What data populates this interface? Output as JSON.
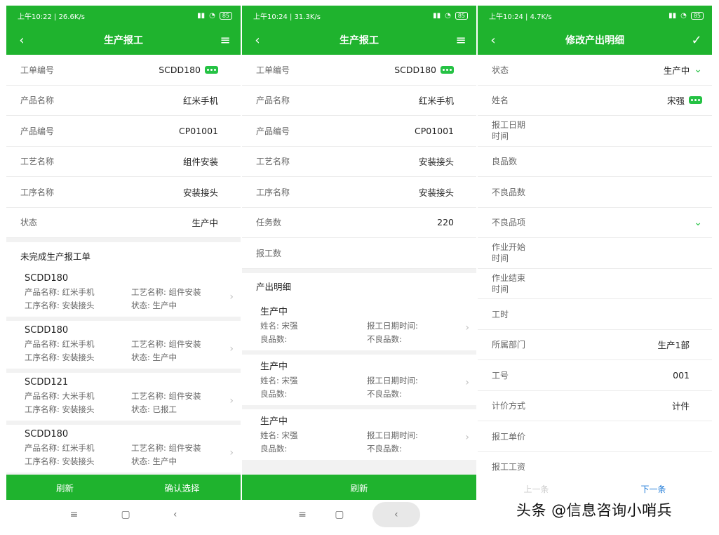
{
  "screen1": {
    "status": {
      "time": "上午10:22",
      "speed": "26.6K/s",
      "battery": "85"
    },
    "title": "生产报工",
    "fields": [
      {
        "label": "工单编号",
        "value": "SCDD180"
      },
      {
        "label": "产品名称",
        "value": "红米手机"
      },
      {
        "label": "产品编号",
        "value": "CP01001"
      },
      {
        "label": "工艺名称",
        "value": "组件安装"
      },
      {
        "label": "工序名称",
        "value": "安装接头"
      },
      {
        "label": "状态",
        "value": "生产中"
      }
    ],
    "section_title": "未完成生产报工单",
    "cards": [
      {
        "code": "SCDD180",
        "product": "产品名称: 红米手机",
        "craft": "工艺名称: 组件安装",
        "process": "工序名称: 安装接头",
        "state": "状态: 生产中"
      },
      {
        "code": "SCDD180",
        "product": "产品名称: 红米手机",
        "craft": "工艺名称: 组件安装",
        "process": "工序名称: 安装接头",
        "state": "状态: 生产中"
      },
      {
        "code": "SCDD121",
        "product": "产品名称: 大米手机",
        "craft": "工艺名称: 组件安装",
        "process": "工序名称: 安装接头",
        "state": "状态: 已报工"
      },
      {
        "code": "SCDD180",
        "product": "产品名称: 红米手机",
        "craft": "工艺名称: 组件安装",
        "process": "工序名称: 安装接头",
        "state": "状态: 生产中"
      }
    ],
    "footer": {
      "refresh": "刷新",
      "confirm": "确认选择"
    }
  },
  "screen2": {
    "status": {
      "time": "上午10:24",
      "speed": "31.3K/s",
      "battery": "85"
    },
    "title": "生产报工",
    "fields": [
      {
        "label": "工单编号",
        "value": "SCDD180"
      },
      {
        "label": "产品名称",
        "value": "红米手机"
      },
      {
        "label": "产品编号",
        "value": "CP01001"
      },
      {
        "label": "工艺名称",
        "value": "安装接头"
      },
      {
        "label": "工序名称",
        "value": "安装接头"
      },
      {
        "label": "任务数",
        "value": "220"
      },
      {
        "label": "报工数",
        "value": ""
      }
    ],
    "section_title": "产出明细",
    "cards": [
      {
        "code": "生产中",
        "name": "姓名: 宋强",
        "date": "报工日期时间:",
        "good": "良品数:",
        "bad": "不良品数:"
      },
      {
        "code": "生产中",
        "name": "姓名: 宋强",
        "date": "报工日期时间:",
        "good": "良品数:",
        "bad": "不良品数:"
      },
      {
        "code": "生产中",
        "name": "姓名: 宋强",
        "date": "报工日期时间:",
        "good": "良品数:",
        "bad": "不良品数:"
      }
    ],
    "footer": {
      "refresh": "刷新"
    }
  },
  "screen3": {
    "status": {
      "time": "上午10:24",
      "speed": "4.7K/s",
      "battery": "85"
    },
    "title": "修改产出明细",
    "fields": [
      {
        "label": "状态",
        "value": "生产中"
      },
      {
        "label": "姓名",
        "value": "宋强"
      },
      {
        "label": "报工日期\n时间",
        "value": ""
      },
      {
        "label": "良品数",
        "value": ""
      },
      {
        "label": "不良品数",
        "value": ""
      },
      {
        "label": "不良品项",
        "value": ""
      },
      {
        "label": "作业开始\n时间",
        "value": ""
      },
      {
        "label": "作业结束\n时间",
        "value": ""
      },
      {
        "label": "工时",
        "value": ""
      },
      {
        "label": "所属部门",
        "value": "生产1部"
      },
      {
        "label": "工号",
        "value": "001"
      },
      {
        "label": "计价方式",
        "value": "计件"
      },
      {
        "label": "报工单价",
        "value": ""
      },
      {
        "label": "报工工资",
        "value": ""
      }
    ],
    "footer": {
      "prev": "上一条",
      "next": "下一条"
    }
  },
  "watermark": "头条 @信息咨询小哨兵",
  "colors": {
    "brand_green": "#1fb32e",
    "link_blue": "#1f7bd8"
  }
}
